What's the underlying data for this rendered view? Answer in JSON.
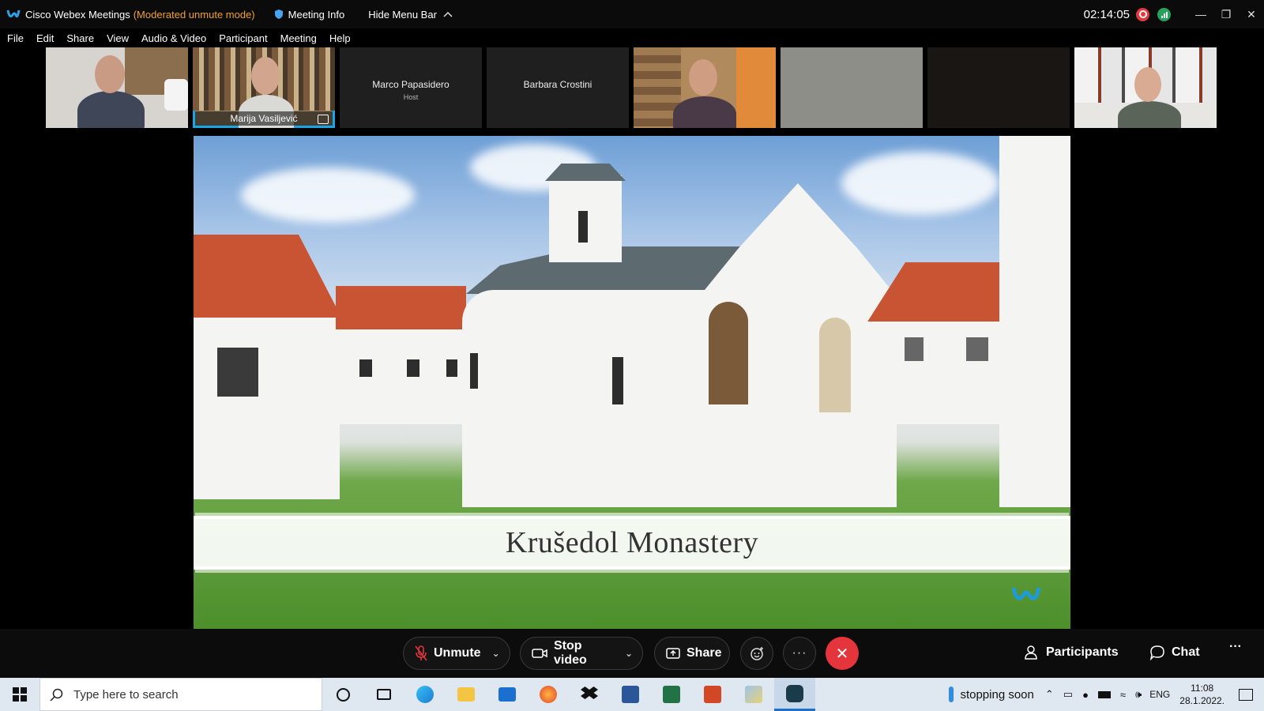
{
  "titlebar": {
    "app_title": "Cisco Webex Meetings",
    "mode": "(Moderated unmute mode)",
    "meeting_info": "Meeting Info",
    "hide_menu": "Hide Menu Bar",
    "clock": "02:14:05"
  },
  "menubar": {
    "items": [
      "File",
      "Edit",
      "Share",
      "View",
      "Audio & Video",
      "Participant",
      "Meeting",
      "Help"
    ]
  },
  "participants": [
    {
      "name": "",
      "video": true
    },
    {
      "name": "Marija Vasiljević",
      "video": true,
      "active_speaker": true
    },
    {
      "name": "Marco Papasidero",
      "role": "Host",
      "video": false
    },
    {
      "name": "Barbara Crostini",
      "video": false
    },
    {
      "name": "",
      "video": true
    },
    {
      "name": "",
      "video": true
    },
    {
      "name": "",
      "video": false
    },
    {
      "name": "",
      "video": true
    }
  ],
  "slide": {
    "title": "Krušedol Monastery"
  },
  "controls": {
    "unmute": "Unmute",
    "stop_video": "Stop video",
    "share": "Share",
    "participants": "Participants",
    "chat": "Chat"
  },
  "taskbar": {
    "search_placeholder": "Type here to search",
    "status": "stopping soon",
    "lang": "ENG",
    "time": "11:08",
    "date": "28.1.2022."
  },
  "colors": {
    "accent": "#19a5e6",
    "mode_text": "#f0a030",
    "end_call": "#e3353b",
    "recording": "#e0393e"
  }
}
